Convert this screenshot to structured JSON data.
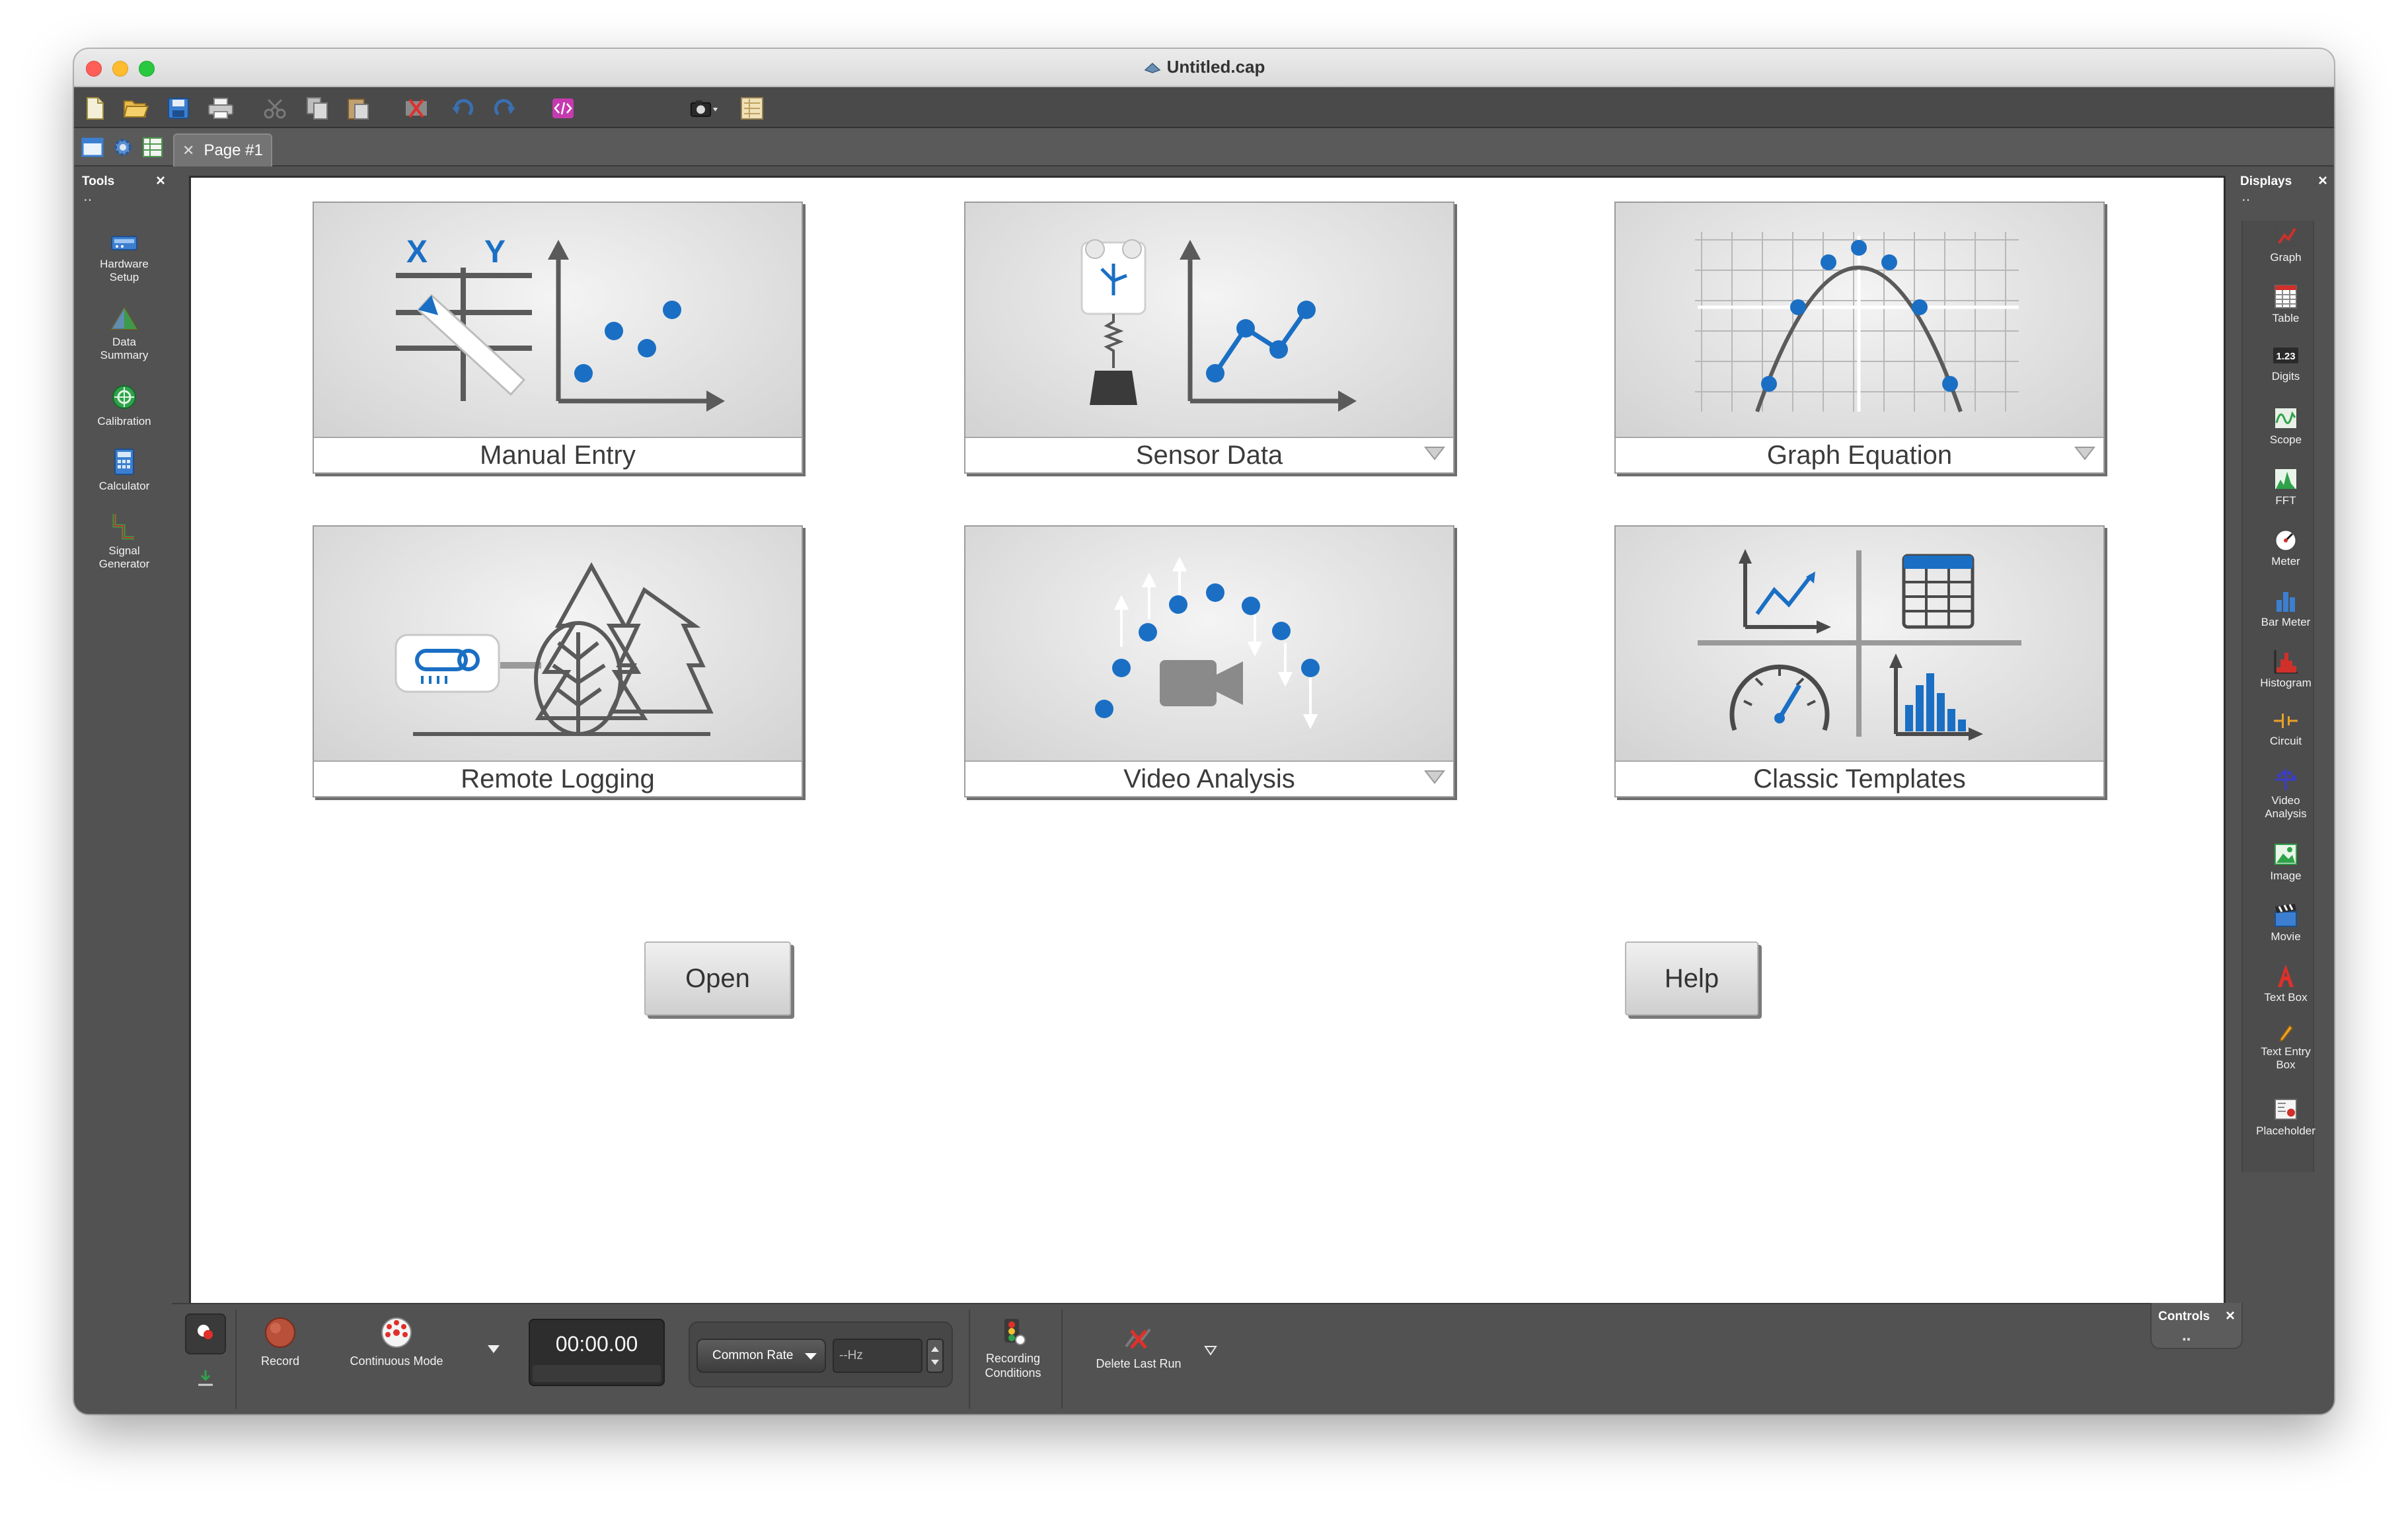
{
  "window": {
    "title": "Untitled.cap"
  },
  "tabs": {
    "page_tab": "Page #1"
  },
  "tools_panel": {
    "title": "Tools",
    "items": [
      {
        "label_lines": [
          "Hardware",
          "Setup"
        ]
      },
      {
        "label_lines": [
          "Data",
          "Summary"
        ]
      },
      {
        "label_lines": [
          "Calibration"
        ]
      },
      {
        "label_lines": [
          "Calculator"
        ]
      },
      {
        "label_lines": [
          "Signal",
          "Generator"
        ]
      }
    ]
  },
  "displays_panel": {
    "title": "Displays",
    "items": [
      {
        "label_lines": [
          "Graph"
        ]
      },
      {
        "label_lines": [
          "Table"
        ]
      },
      {
        "label_lines": [
          "Digits"
        ]
      },
      {
        "label_lines": [
          "Scope"
        ]
      },
      {
        "label_lines": [
          "FFT"
        ]
      },
      {
        "label_lines": [
          "Meter"
        ]
      },
      {
        "label_lines": [
          "Bar Meter"
        ]
      },
      {
        "label_lines": [
          "Histogram"
        ]
      },
      {
        "label_lines": [
          "Circuit"
        ]
      },
      {
        "label_lines": [
          "Video",
          "Analysis"
        ]
      },
      {
        "label_lines": [
          "Image"
        ]
      },
      {
        "label_lines": [
          "Movie"
        ]
      },
      {
        "label_lines": [
          "Text Box"
        ]
      },
      {
        "label_lines": [
          "Text Entry",
          "Box"
        ]
      },
      {
        "label_lines": [
          "Placeholder"
        ]
      }
    ],
    "digits_icon_text": "1.23"
  },
  "cards": {
    "manual_entry": "Manual Entry",
    "sensor_data": "Sensor Data",
    "graph_equation": "Graph Equation",
    "remote_logging": "Remote Logging",
    "video_analysis": "Video Analysis",
    "classic_templates": "Classic Templates",
    "axis_x": "X",
    "axis_y": "Y"
  },
  "buttons": {
    "open": "Open",
    "help": "Help"
  },
  "controls": {
    "record": "Record",
    "continuous_mode": "Continuous Mode",
    "timer": "00:00.00",
    "common_rate": "Common Rate",
    "hz_value": "--Hz",
    "recording_conditions": [
      "Recording",
      "Conditions"
    ],
    "delete_last_run": "Delete Last Run",
    "panel_title": "Controls"
  },
  "colors": {
    "accent_blue": "#1a6fc4",
    "art_gray": "#5a5a5a",
    "window_dark": "#525252"
  }
}
